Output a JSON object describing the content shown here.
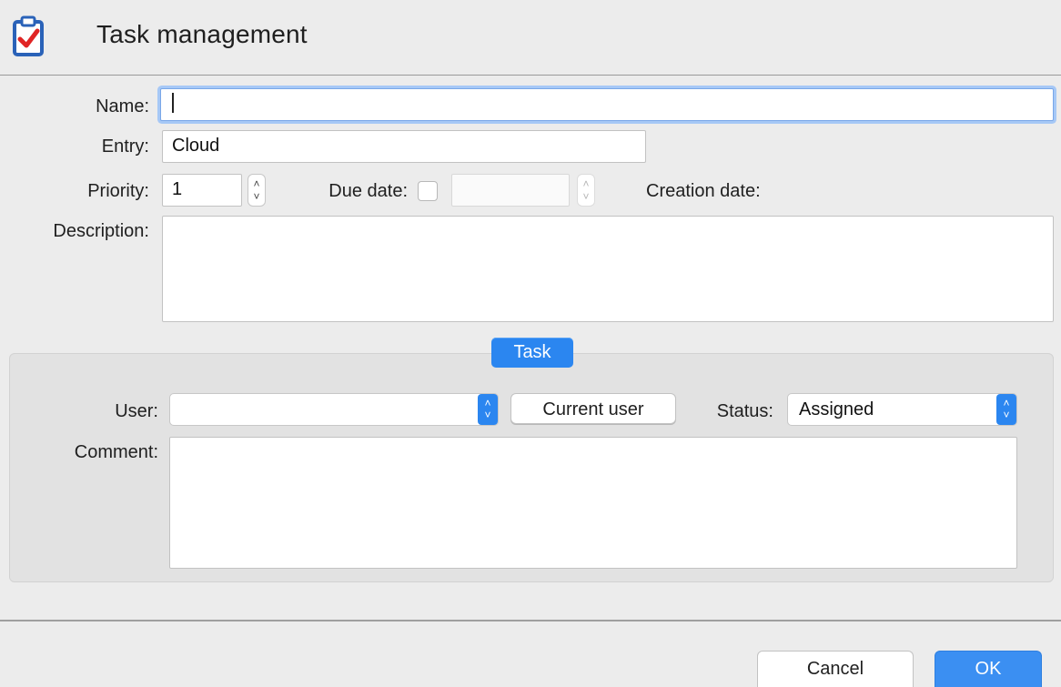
{
  "window": {
    "title": "Task management",
    "icon": "clipboard-check-icon"
  },
  "form": {
    "name_label": "Name:",
    "name_value": "",
    "entry_label": "Entry:",
    "entry_value": "Cloud",
    "priority_label": "Priority:",
    "priority_value": "1",
    "due_date_label": "Due date:",
    "due_date_checked": false,
    "due_date_value": "",
    "creation_date_label": "Creation date:",
    "description_label": "Description:",
    "description_value": ""
  },
  "task_group": {
    "tab_label": "Task",
    "user_label": "User:",
    "user_value": "",
    "current_user_button": "Current user",
    "status_label": "Status:",
    "status_value": "Assigned",
    "comment_label": "Comment:",
    "comment_value": ""
  },
  "footer": {
    "cancel_label": "Cancel",
    "ok_label": "OK"
  },
  "colors": {
    "accent": "#2b86f0",
    "focus_ring": "#a6c8f6",
    "check_red": "#e02424",
    "icon_blue": "#2a62b8"
  }
}
